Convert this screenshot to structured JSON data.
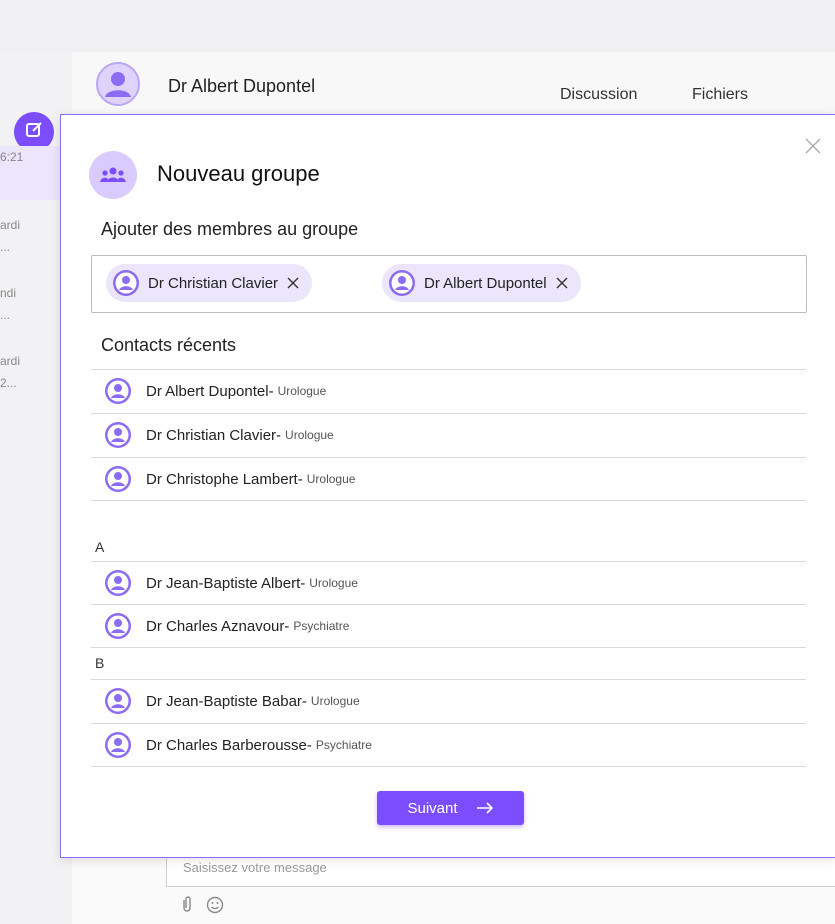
{
  "sidebar": {
    "items": [
      {
        "text": "6:21"
      },
      {
        "text": "ardi"
      },
      {
        "text": "..."
      },
      {
        "text": "ndi"
      },
      {
        "text": "..."
      },
      {
        "text": "ardi"
      },
      {
        "text": "2..."
      }
    ]
  },
  "header": {
    "name": "Dr Albert Dupontel",
    "tabs": [
      "Discussion",
      "Fichiers"
    ]
  },
  "modal": {
    "title": "Nouveau groupe",
    "add_members_label": "Ajouter des membres au groupe",
    "selected_chips": [
      {
        "name": "Dr Christian Clavier"
      },
      {
        "name": "Dr Albert Dupontel"
      }
    ],
    "recent_label": "Contacts récents",
    "recent": [
      {
        "name": "Dr Albert Dupontel",
        "sep": " -",
        "specialty": "Urologue"
      },
      {
        "name": "Dr Christian Clavier",
        "sep": " -",
        "specialty": "Urologue"
      },
      {
        "name": "Dr Christophe Lambert",
        "sep": " -",
        "specialty": "Urologue"
      }
    ],
    "groups": [
      {
        "letter": "A",
        "contacts": [
          {
            "name": "Dr Jean-Baptiste Albert",
            "sep": " -",
            "specialty": "Urologue"
          },
          {
            "name": "Dr Charles Aznavour",
            "sep": " -",
            "specialty": "Psychiatre"
          }
        ]
      },
      {
        "letter": "B",
        "contacts": [
          {
            "name": "Dr Jean-Baptiste Babar",
            "sep": " -",
            "specialty": "Urologue"
          },
          {
            "name": "Dr Charles Barberousse",
            "sep": " -",
            "specialty": "Psychiatre"
          }
        ]
      }
    ],
    "next_label": "Suivant"
  },
  "composer": {
    "placeholder": "Saisissez votre message"
  },
  "colors": {
    "accent": "#7c4dff",
    "accent_light": "#ebe6fb",
    "avatar_fill": "#8c6cf2"
  }
}
